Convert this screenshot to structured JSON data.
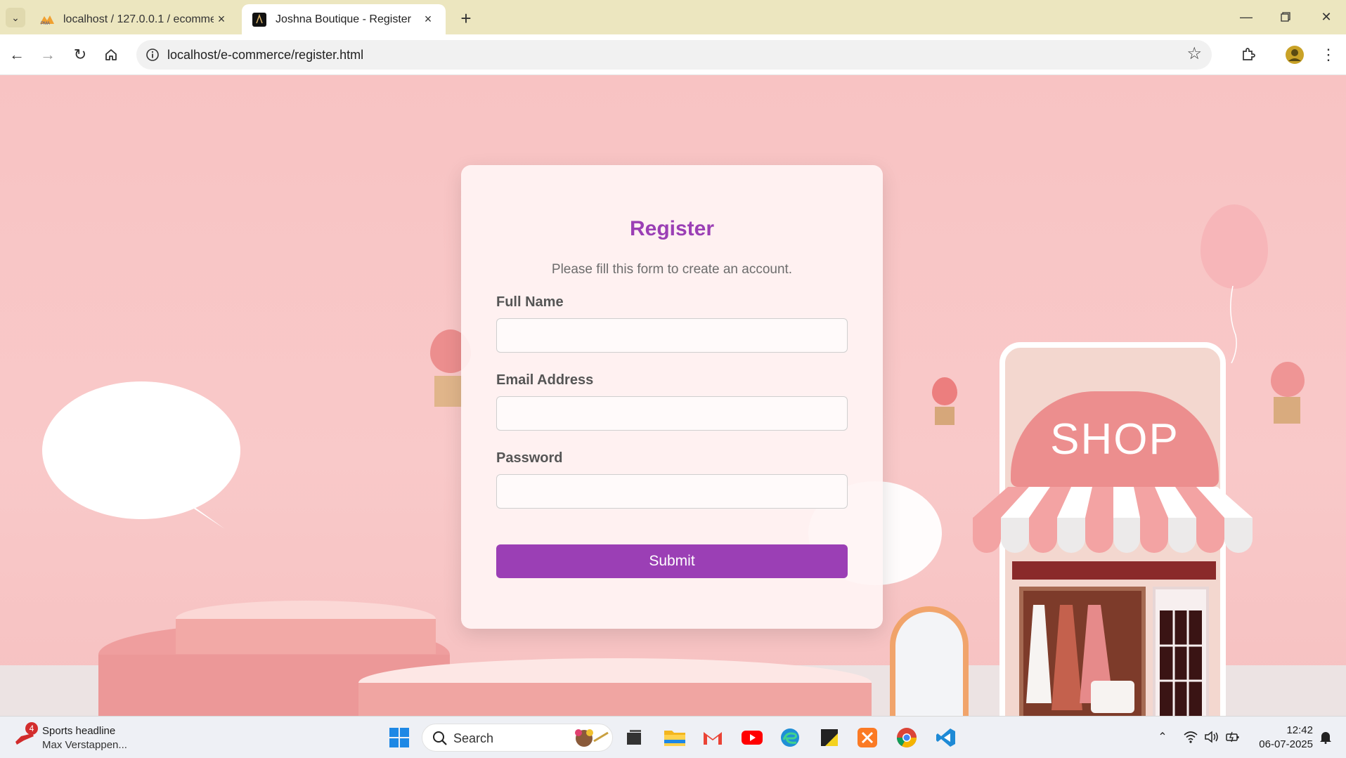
{
  "browser": {
    "tabs": [
      {
        "title": "localhost / 127.0.0.1 / ecommer",
        "active": false,
        "icon": "phpmyadmin-icon"
      },
      {
        "title": "Joshna Boutique - Register",
        "active": true,
        "icon": "boutique-icon"
      }
    ],
    "address": "localhost/e-commerce/register.html"
  },
  "page": {
    "heading": "Register",
    "subtitle": "Please fill this form to create an account.",
    "fields": [
      {
        "label": "Full Name",
        "value": ""
      },
      {
        "label": "Email Address",
        "value": ""
      },
      {
        "label": "Password",
        "value": ""
      }
    ],
    "submit_label": "Submit",
    "shop_sign": "SHOP",
    "colors": {
      "accent": "#9b3fb5",
      "background": "#f8c3c3"
    }
  },
  "taskbar": {
    "news_title": "Sports headline",
    "news_subtitle": "Max Verstappen...",
    "news_badge": "4",
    "search_label": "Search",
    "time": "12:42",
    "date": "06-07-2025"
  }
}
